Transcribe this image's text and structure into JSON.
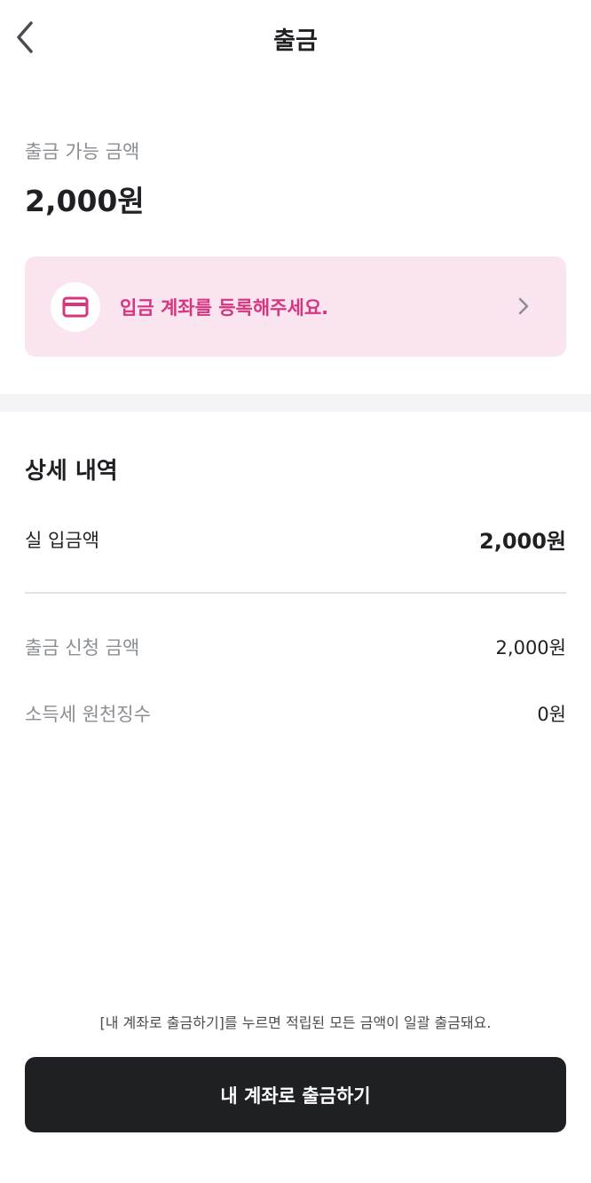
{
  "header": {
    "title": "출금",
    "back_icon": "chevron-left-icon"
  },
  "available": {
    "label": "출금 가능 금액",
    "amount": "2,000원"
  },
  "register_banner": {
    "text": "입금 계좌를 등록해주세요.",
    "icon": "credit-card-icon",
    "accent": "#d6357f",
    "background": "#f9e4f0"
  },
  "details": {
    "title": "상세 내역",
    "net_label": "실 입금액",
    "net_value": "2,000원",
    "request_label": "출금 신청 금액",
    "request_value": "2,000원",
    "tax_label": "소득세 원천징수",
    "tax_value": "0원"
  },
  "footer": {
    "notice": "[내 계좌로 출금하기]를 누르면 적립된 모든 금액이 일괄 출금돼요.",
    "button_label": "내 계좌로 출금하기",
    "button_color": "#1f2024"
  }
}
